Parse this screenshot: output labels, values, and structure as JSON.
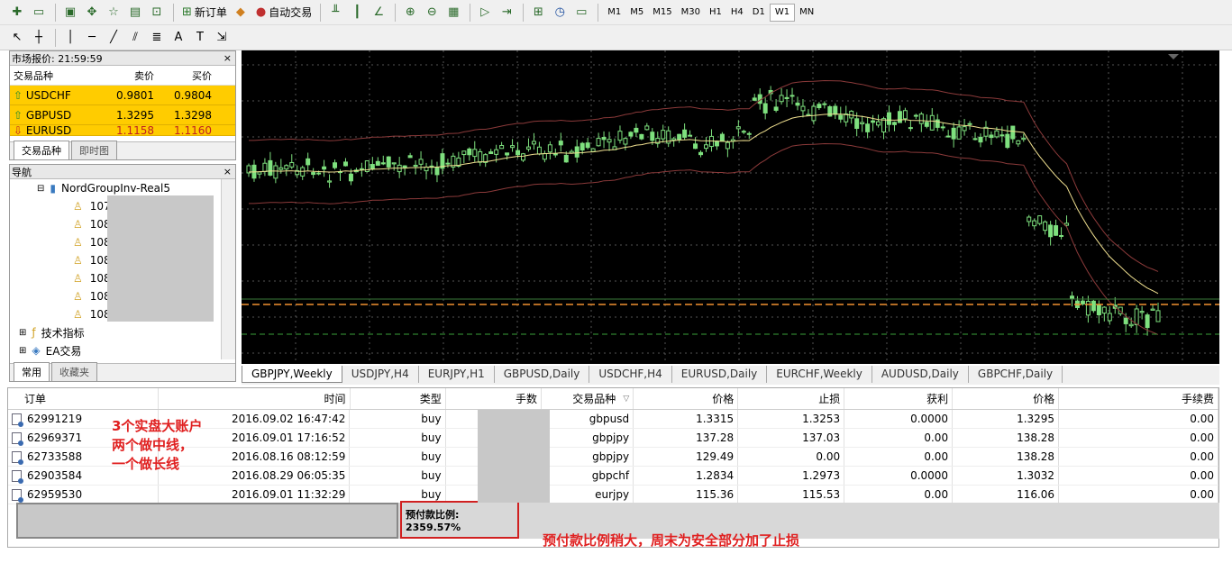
{
  "toolbar": {
    "new_order": "新订单",
    "auto_trading": "自动交易",
    "timeframes": [
      "M1",
      "M5",
      "M15",
      "M30",
      "H1",
      "H4",
      "D1",
      "W1",
      "MN"
    ],
    "active_timeframe": "W1"
  },
  "market_watch": {
    "title": "市场报价: 21:59:59",
    "col_symbol": "交易品种",
    "col_bid": "卖价",
    "col_ask": "买价",
    "rows": [
      {
        "symbol": "USDCHF",
        "bid": "0.9801",
        "ask": "0.9804",
        "dir": "up"
      },
      {
        "symbol": "GBPUSD",
        "bid": "1.3295",
        "ask": "1.3298",
        "dir": "up"
      },
      {
        "symbol": "EURUSD",
        "bid": "1.1158",
        "ask": "1.1160",
        "dir": "down"
      }
    ],
    "tabs": [
      "交易品种",
      "即时图"
    ]
  },
  "navigator": {
    "title": "导航",
    "account_server": "NordGroupInv-Real5",
    "accounts": [
      "107",
      "108",
      "108",
      "108",
      "108",
      "108",
      "108"
    ],
    "indicators": "技术指标",
    "experts": "EA交易",
    "tabs": [
      "常用",
      "收藏夹"
    ]
  },
  "chart_tabs": [
    "GBPJPY,Weekly",
    "USDJPY,H4",
    "EURJPY,H1",
    "GBPUSD,Daily",
    "USDCHF,H4",
    "EURUSD,Daily",
    "EURCHF,Weekly",
    "AUDUSD,Daily",
    "GBPCHF,Daily"
  ],
  "terminal": {
    "headers": [
      "订单",
      "时间",
      "类型",
      "手数",
      "交易品种",
      "价格",
      "止损",
      "获利",
      "价格",
      "手续费"
    ],
    "rows": [
      {
        "order": "62991219",
        "time": "2016.09.02 16:47:42",
        "type": "buy",
        "symbol": "gbpusd",
        "price": "1.3315",
        "sl": "1.3253",
        "tp": "0.0000",
        "cur": "1.3295",
        "fee": "0.00"
      },
      {
        "order": "62969371",
        "time": "2016.09.01 17:16:52",
        "type": "buy",
        "symbol": "gbpjpy",
        "price": "137.28",
        "sl": "137.03",
        "tp": "0.00",
        "cur": "138.28",
        "fee": "0.00"
      },
      {
        "order": "62733588",
        "time": "2016.08.16 08:12:59",
        "type": "buy",
        "symbol": "gbpjpy",
        "price": "129.49",
        "sl": "0.00",
        "tp": "0.00",
        "cur": "138.28",
        "fee": "0.00"
      },
      {
        "order": "62903584",
        "time": "2016.08.29 06:05:35",
        "type": "buy",
        "symbol": "gbpchf",
        "price": "1.2834",
        "sl": "1.2973",
        "tp": "0.0000",
        "cur": "1.3032",
        "fee": "0.00"
      },
      {
        "order": "62959530",
        "time": "2016.09.01 11:32:29",
        "type": "buy",
        "symbol": "eurjpy",
        "price": "115.36",
        "sl": "115.53",
        "tp": "0.00",
        "cur": "116.06",
        "fee": "0.00"
      }
    ],
    "margin_level": "预付款比例: 2359.57%"
  },
  "annotations": {
    "note1_line1": "3个实盘大账户",
    "note1_line2": "两个做中线，",
    "note1_line3": "一个做长线",
    "note2": "预付款比例稍大，周末为安全部分加了止损"
  },
  "colors": {
    "chart_bg": "#000000",
    "candle": "#7ee07e",
    "bands": "#8b3a3a",
    "ma": "#f0e090",
    "market_row": "#ffcc00",
    "annotation": "#e02020"
  }
}
